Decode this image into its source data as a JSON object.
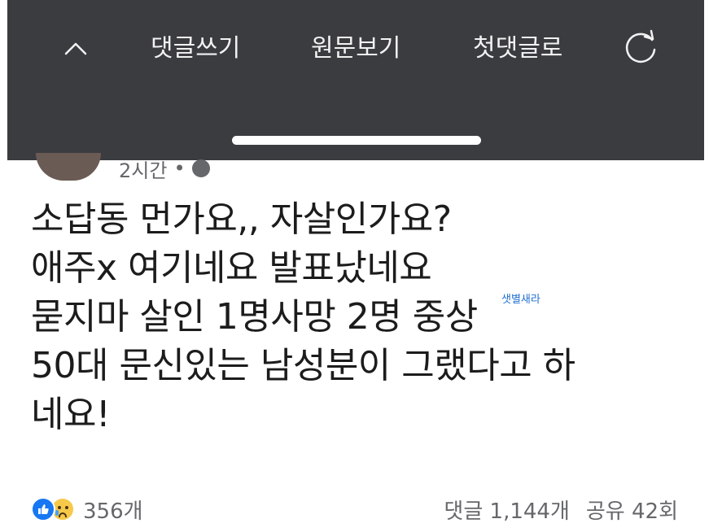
{
  "toolbar": {
    "collapse_icon": "chevron-up-icon",
    "write_comment": "댓글쓰기",
    "view_original": "원문보기",
    "first_comment": "첫댓글로",
    "refresh_icon": "refresh-icon",
    "background_color": "#3b3c40"
  },
  "post": {
    "timestamp": "2시간",
    "separator": "•",
    "privacy_icon": "globe-icon",
    "lines": [
      "소답동 먼가요,, 자살인가요?",
      "애주x 여기네요  발표났네요",
      "묻지마 살인 1명사망 2명 중상",
      "50대 문신있는 남성분이 그랬다고 하",
      "네요!"
    ],
    "watermark": "샛별새라"
  },
  "footer": {
    "reaction_icons": [
      "like-icon",
      "sad-icon"
    ],
    "reaction_count": "356개",
    "comments": "댓글 1,144개",
    "shares": "공유 42회"
  }
}
